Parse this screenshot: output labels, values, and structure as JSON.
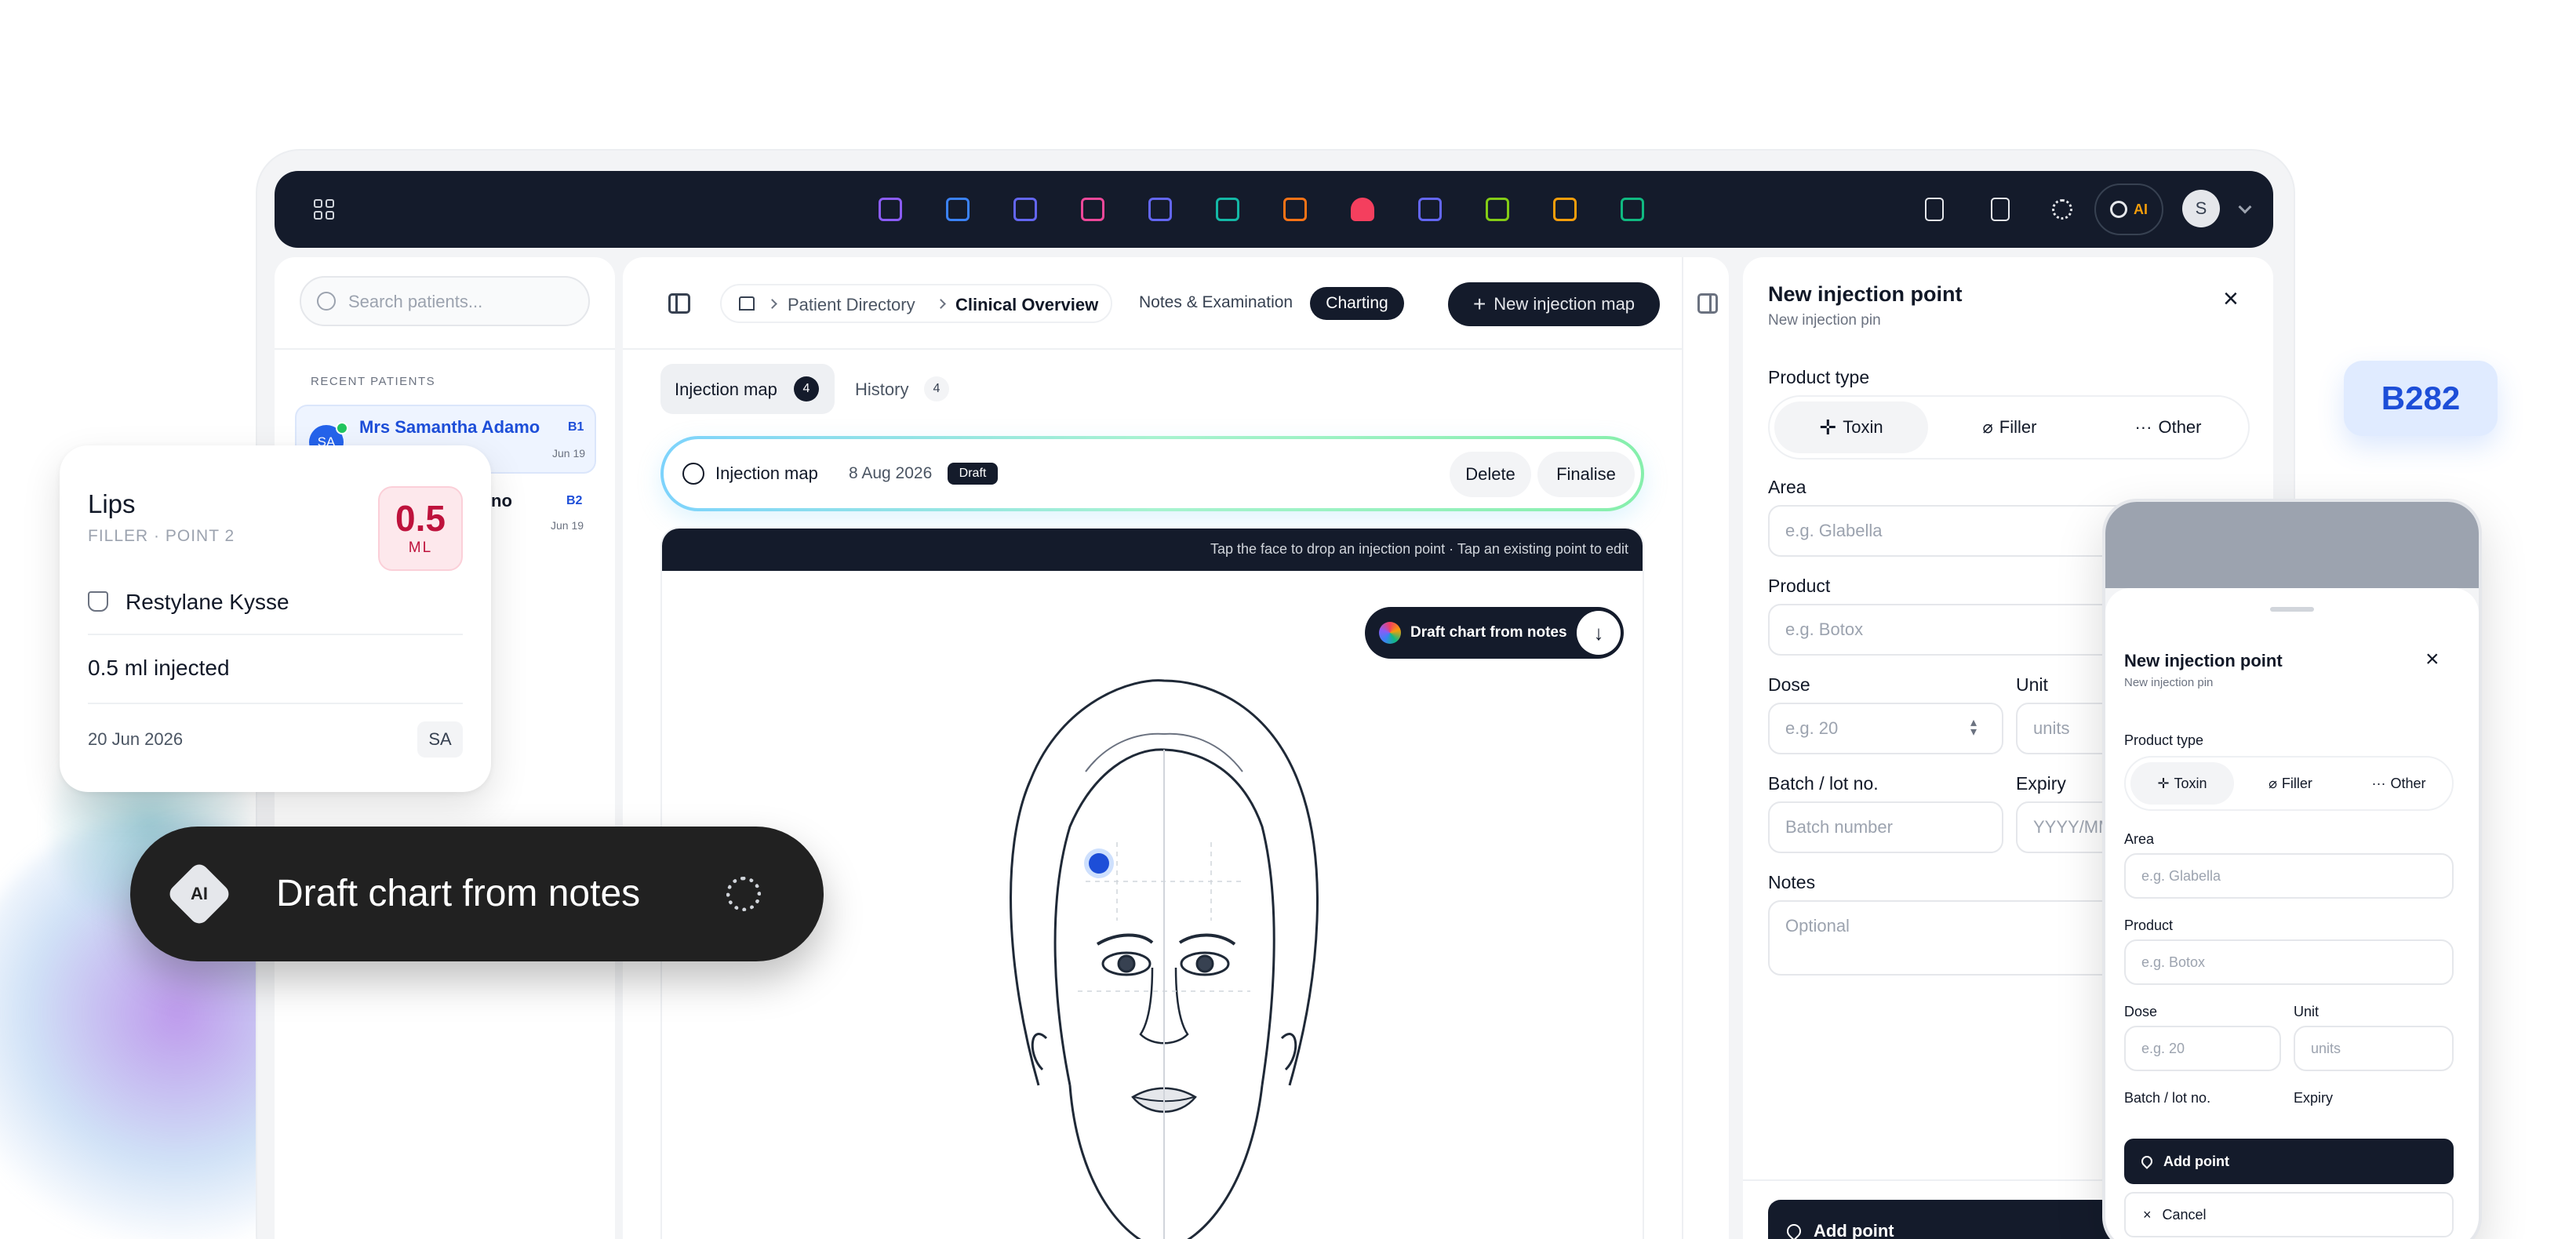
{
  "topbar": {
    "ai_label": "AI",
    "avatar": "S",
    "icons": [
      "presentation-icon",
      "folder-icon",
      "edit-icon",
      "copy-icon",
      "send-icon",
      "book-icon",
      "chart-icon",
      "heart-icon",
      "calendar-icon",
      "truck-icon",
      "archive-icon",
      "money-icon"
    ],
    "icon_colors": [
      "#8b5cf6",
      "#3b82f6",
      "#6366f1",
      "#ec4899",
      "#6366f1",
      "#14b8a6",
      "#f97316",
      "#f43f5e",
      "#6366f1",
      "#84cc16",
      "#f59e0b",
      "#10b981"
    ]
  },
  "sidebar": {
    "search_placeholder": "Search patients...",
    "section_label": "RECENT PATIENTS",
    "patients": [
      {
        "initials": "SA",
        "name": "Mrs Samantha Adamo",
        "badge": "B1",
        "date": "Jun 19"
      },
      {
        "name_fragment": "no",
        "badge": "B2",
        "date": "Jun 19"
      }
    ]
  },
  "breadcrumb": {
    "items": [
      "Patient Directory",
      "Clinical Overview"
    ],
    "tabs": [
      "Notes & Examination",
      "Charting"
    ],
    "active_tab": "Charting"
  },
  "main": {
    "new_map_label": "New injection map",
    "tabs": [
      {
        "label": "Injection map",
        "count": "4"
      },
      {
        "label": "History",
        "count": "4"
      }
    ],
    "map_card": {
      "title": "Injection map",
      "date": "8 Aug 2026",
      "status": "Draft",
      "delete": "Delete",
      "finalise": "Finalise"
    },
    "hint": "Tap the face to drop an injection point · Tap an existing point to edit",
    "draft_button": "Draft chart from notes"
  },
  "panel": {
    "title": "New injection point",
    "subtitle": "New injection pin",
    "product_type_label": "Product type",
    "types": [
      "Toxin",
      "Filler",
      "Other"
    ],
    "area_label": "Area",
    "area_placeholder": "e.g. Glabella",
    "product_label": "Product",
    "product_placeholder": "e.g. Botox",
    "dose_label": "Dose",
    "dose_placeholder": "e.g. 20",
    "unit_label": "Unit",
    "unit_placeholder": "units",
    "batch_label": "Batch / lot no.",
    "batch_placeholder": "Batch number",
    "expiry_label": "Expiry",
    "expiry_placeholder": "YYYY/MM",
    "notes_label": "Notes",
    "notes_placeholder": "Optional",
    "add_point": "Add point"
  },
  "floating_tag": "B282",
  "mobile": {
    "title": "New injection point",
    "subtitle": "New injection pin",
    "product_type_label": "Product type",
    "types": [
      "Toxin",
      "Filler",
      "Other"
    ],
    "area_label": "Area",
    "area_placeholder": "e.g. Glabella",
    "product_label": "Product",
    "product_placeholder": "e.g. Botox",
    "dose_label": "Dose",
    "dose_placeholder": "e.g. 20",
    "unit_label": "Unit",
    "unit_placeholder": "units",
    "batch_label": "Batch / lot no.",
    "expiry_label": "Expiry",
    "add_point": "Add point",
    "cancel": "Cancel"
  },
  "lips_card": {
    "title": "Lips",
    "subtitle": "FILLER · POINT 2",
    "amount": "0.5",
    "amount_unit": "ML",
    "product": "Restylane Kysse",
    "injected": "0.5 ml injected",
    "date": "20 Jun 2026",
    "initials": "SA"
  },
  "ai_pill": {
    "badge": "AI",
    "label": "Draft chart from notes"
  }
}
